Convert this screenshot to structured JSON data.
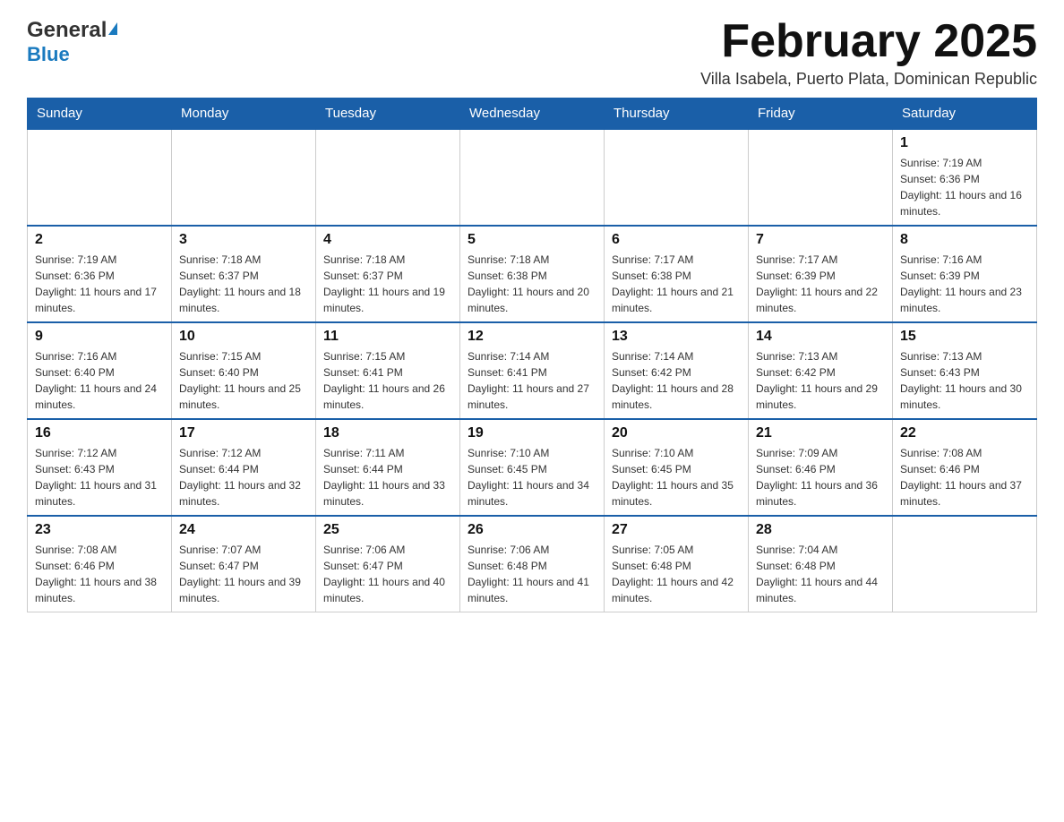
{
  "header": {
    "logo_general": "General",
    "logo_blue": "Blue",
    "month_title": "February 2025",
    "subtitle": "Villa Isabela, Puerto Plata, Dominican Republic"
  },
  "days_of_week": [
    "Sunday",
    "Monday",
    "Tuesday",
    "Wednesday",
    "Thursday",
    "Friday",
    "Saturday"
  ],
  "weeks": [
    [
      {
        "day": "",
        "info": ""
      },
      {
        "day": "",
        "info": ""
      },
      {
        "day": "",
        "info": ""
      },
      {
        "day": "",
        "info": ""
      },
      {
        "day": "",
        "info": ""
      },
      {
        "day": "",
        "info": ""
      },
      {
        "day": "1",
        "info": "Sunrise: 7:19 AM\nSunset: 6:36 PM\nDaylight: 11 hours and 16 minutes."
      }
    ],
    [
      {
        "day": "2",
        "info": "Sunrise: 7:19 AM\nSunset: 6:36 PM\nDaylight: 11 hours and 17 minutes."
      },
      {
        "day": "3",
        "info": "Sunrise: 7:18 AM\nSunset: 6:37 PM\nDaylight: 11 hours and 18 minutes."
      },
      {
        "day": "4",
        "info": "Sunrise: 7:18 AM\nSunset: 6:37 PM\nDaylight: 11 hours and 19 minutes."
      },
      {
        "day": "5",
        "info": "Sunrise: 7:18 AM\nSunset: 6:38 PM\nDaylight: 11 hours and 20 minutes."
      },
      {
        "day": "6",
        "info": "Sunrise: 7:17 AM\nSunset: 6:38 PM\nDaylight: 11 hours and 21 minutes."
      },
      {
        "day": "7",
        "info": "Sunrise: 7:17 AM\nSunset: 6:39 PM\nDaylight: 11 hours and 22 minutes."
      },
      {
        "day": "8",
        "info": "Sunrise: 7:16 AM\nSunset: 6:39 PM\nDaylight: 11 hours and 23 minutes."
      }
    ],
    [
      {
        "day": "9",
        "info": "Sunrise: 7:16 AM\nSunset: 6:40 PM\nDaylight: 11 hours and 24 minutes."
      },
      {
        "day": "10",
        "info": "Sunrise: 7:15 AM\nSunset: 6:40 PM\nDaylight: 11 hours and 25 minutes."
      },
      {
        "day": "11",
        "info": "Sunrise: 7:15 AM\nSunset: 6:41 PM\nDaylight: 11 hours and 26 minutes."
      },
      {
        "day": "12",
        "info": "Sunrise: 7:14 AM\nSunset: 6:41 PM\nDaylight: 11 hours and 27 minutes."
      },
      {
        "day": "13",
        "info": "Sunrise: 7:14 AM\nSunset: 6:42 PM\nDaylight: 11 hours and 28 minutes."
      },
      {
        "day": "14",
        "info": "Sunrise: 7:13 AM\nSunset: 6:42 PM\nDaylight: 11 hours and 29 minutes."
      },
      {
        "day": "15",
        "info": "Sunrise: 7:13 AM\nSunset: 6:43 PM\nDaylight: 11 hours and 30 minutes."
      }
    ],
    [
      {
        "day": "16",
        "info": "Sunrise: 7:12 AM\nSunset: 6:43 PM\nDaylight: 11 hours and 31 minutes."
      },
      {
        "day": "17",
        "info": "Sunrise: 7:12 AM\nSunset: 6:44 PM\nDaylight: 11 hours and 32 minutes."
      },
      {
        "day": "18",
        "info": "Sunrise: 7:11 AM\nSunset: 6:44 PM\nDaylight: 11 hours and 33 minutes."
      },
      {
        "day": "19",
        "info": "Sunrise: 7:10 AM\nSunset: 6:45 PM\nDaylight: 11 hours and 34 minutes."
      },
      {
        "day": "20",
        "info": "Sunrise: 7:10 AM\nSunset: 6:45 PM\nDaylight: 11 hours and 35 minutes."
      },
      {
        "day": "21",
        "info": "Sunrise: 7:09 AM\nSunset: 6:46 PM\nDaylight: 11 hours and 36 minutes."
      },
      {
        "day": "22",
        "info": "Sunrise: 7:08 AM\nSunset: 6:46 PM\nDaylight: 11 hours and 37 minutes."
      }
    ],
    [
      {
        "day": "23",
        "info": "Sunrise: 7:08 AM\nSunset: 6:46 PM\nDaylight: 11 hours and 38 minutes."
      },
      {
        "day": "24",
        "info": "Sunrise: 7:07 AM\nSunset: 6:47 PM\nDaylight: 11 hours and 39 minutes."
      },
      {
        "day": "25",
        "info": "Sunrise: 7:06 AM\nSunset: 6:47 PM\nDaylight: 11 hours and 40 minutes."
      },
      {
        "day": "26",
        "info": "Sunrise: 7:06 AM\nSunset: 6:48 PM\nDaylight: 11 hours and 41 minutes."
      },
      {
        "day": "27",
        "info": "Sunrise: 7:05 AM\nSunset: 6:48 PM\nDaylight: 11 hours and 42 minutes."
      },
      {
        "day": "28",
        "info": "Sunrise: 7:04 AM\nSunset: 6:48 PM\nDaylight: 11 hours and 44 minutes."
      },
      {
        "day": "",
        "info": ""
      }
    ]
  ]
}
